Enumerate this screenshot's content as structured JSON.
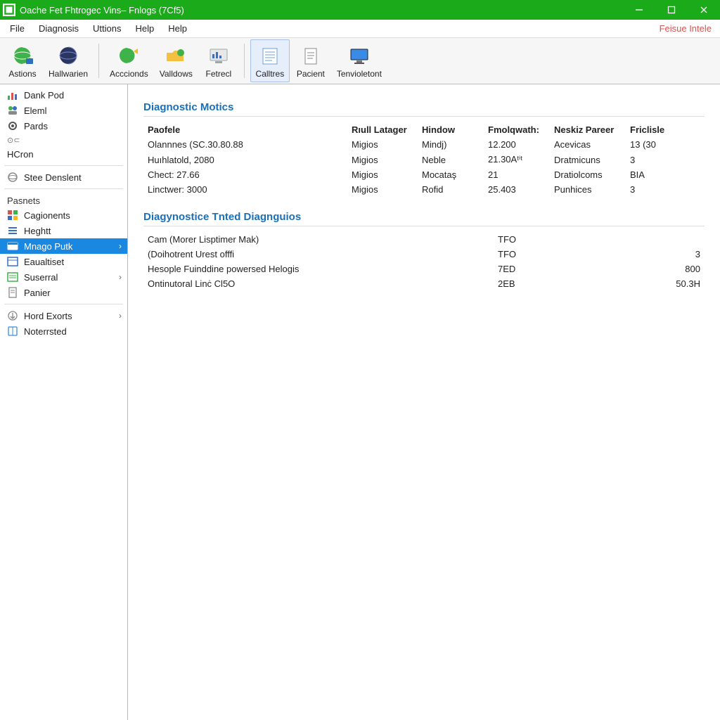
{
  "titlebar": {
    "title": "Oache Fet Fhtrogec Vins– Fnlogs (7Cf5)"
  },
  "menubar": {
    "items": [
      "File",
      "Diagnosis",
      "Uttions",
      "Help",
      "Help"
    ],
    "right": "Feisue Intele"
  },
  "toolbar": {
    "items": [
      {
        "label": "Astions"
      },
      {
        "label": "Hallwarien"
      },
      {
        "label": "Acccionds"
      },
      {
        "label": "Valldows"
      },
      {
        "label": "Fetrecl"
      },
      {
        "label": "Calltres"
      },
      {
        "label": "Pacient"
      },
      {
        "label": "Tenvioletont"
      }
    ],
    "active_index": 5,
    "separators_after": [
      1,
      4
    ]
  },
  "sidebar": {
    "group1": [
      {
        "label": "Dank Pod",
        "icon": "dank"
      },
      {
        "label": "Eleml",
        "icon": "elem"
      },
      {
        "label": "Pards",
        "icon": "pards"
      },
      {
        "label": "⊙⊂",
        "icon": "none",
        "tiny": true
      },
      {
        "label": "HCron",
        "icon": "none"
      }
    ],
    "group2": [
      {
        "label": "Stee Denslent",
        "icon": "globe"
      }
    ],
    "header2": "Pasnets",
    "group3": [
      {
        "label": "Cagionents",
        "icon": "cagion"
      },
      {
        "label": "Heghtt",
        "icon": "height"
      },
      {
        "label": "Mnago Putk",
        "icon": "mnago",
        "selected": true,
        "chev": true
      },
      {
        "label": "Eaualtiset",
        "icon": "eaual"
      },
      {
        "label": "Suserral",
        "icon": "suser",
        "chev": true
      },
      {
        "label": "Panier",
        "icon": "panier"
      }
    ],
    "group4": [
      {
        "label": "Hord Exorts",
        "icon": "hord",
        "chev": true
      },
      {
        "label": "Noterrsted",
        "icon": "noter"
      }
    ]
  },
  "main": {
    "section1": {
      "title": "Diagnostic Motics",
      "headers": [
        "Paofele",
        "Rıull Latager",
        "Hindow",
        "Fmolqwath:",
        "Neskiz Pareer",
        "Friclisle"
      ],
      "rows": [
        [
          "Olannnes (SC.30.80.88",
          "Migios",
          "Mindj)",
          "12.200",
          "Acevicas",
          "13 (30"
        ],
        [
          "Huıhlatold, 2080",
          "Migios",
          "Neble",
          "21.30Aᵗⁱᵗ",
          "Dratmicuns",
          "3"
        ],
        [
          "Chect: 27.66",
          "Migios",
          "Mocataş",
          "21",
          "Dratiolcoms",
          "BIA"
        ],
        [
          "Linctwer: 3000",
          "Migios",
          "Rofid",
          "25.403",
          "Punhices",
          "3"
        ]
      ]
    },
    "section2": {
      "title": "Diagynostice Tnted Diagnguios",
      "rows": [
        [
          "Cam (Morer Lisptimer Mak)",
          "TFO",
          ""
        ],
        [
          "(Doihotrent Urest offfi",
          "TFO",
          "3"
        ],
        [
          "Hesople Fuinddine powersed Helogis",
          "7ED",
          "800"
        ],
        [
          "Ontinutoral Linċ Cl5O",
          "2EB",
          "50.3H"
        ]
      ]
    }
  }
}
